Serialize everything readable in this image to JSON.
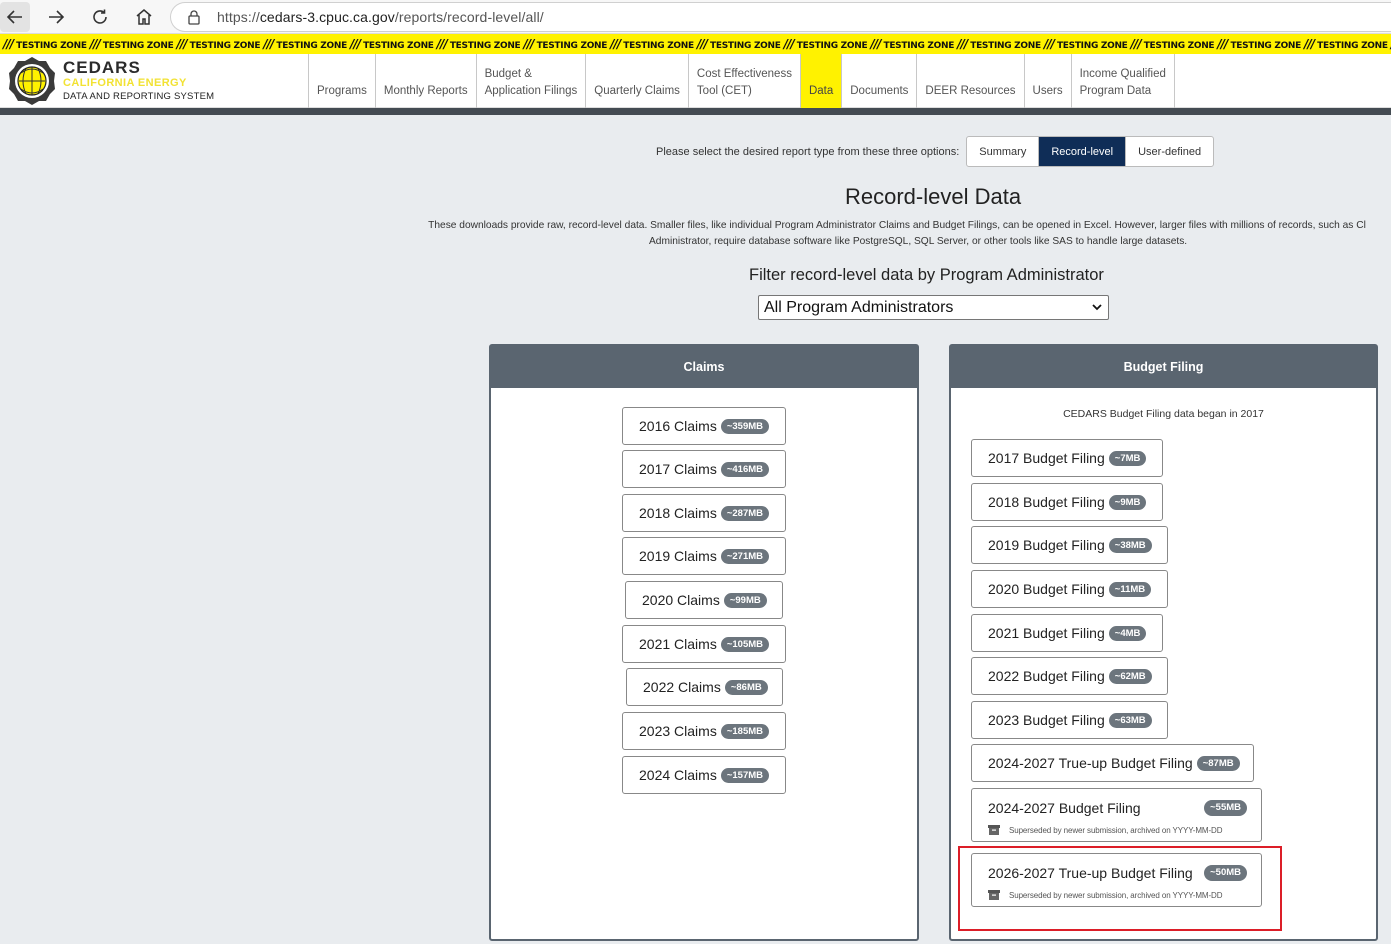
{
  "browser": {
    "url_scheme": "https://",
    "url_host": "cedars-3.cpuc.ca.gov",
    "url_path": "/reports/record-level/all/"
  },
  "testing_zone": {
    "text": "TESTING ZONE",
    "repeat": 19
  },
  "header": {
    "logo_title": "CEDARS",
    "logo_subtitle": "CALIFORNIA ENERGY",
    "logo_subtitle2": "DATA AND REPORTING SYSTEM",
    "nav": [
      {
        "label": "Programs",
        "line2": ""
      },
      {
        "label": "Monthly Reports",
        "line2": ""
      },
      {
        "label": "Budget &",
        "line2": "Application Filings"
      },
      {
        "label": "Quarterly Claims",
        "line2": ""
      },
      {
        "label": "Cost Effectiveness",
        "line2": "Tool (CET)"
      },
      {
        "label": "Data",
        "line2": ""
      },
      {
        "label": "Documents",
        "line2": ""
      },
      {
        "label": "DEER Resources",
        "line2": ""
      },
      {
        "label": "Users",
        "line2": ""
      },
      {
        "label": "Income Qualified",
        "line2": "Program Data"
      }
    ],
    "active_nav": "Data"
  },
  "report_type": {
    "label": "Please select the desired report type from these three options:",
    "options": [
      "Summary",
      "Record-level",
      "User-defined"
    ],
    "selected": "Record-level"
  },
  "page": {
    "title": "Record-level Data",
    "description_line1": "These downloads provide raw, record-level data. Smaller files, like individual Program Administrator Claims and Budget Filings, can be opened in Excel. However, larger files with millions of records, such as Cl",
    "description_line2": "Administrator, require database software like PostgreSQL, SQL Server, or other tools like SAS to handle large datasets."
  },
  "filter": {
    "title": "Filter record-level data by Program Administrator",
    "selected": "All Program Administrators"
  },
  "claims": {
    "header": "Claims",
    "items": [
      {
        "label": "2016 Claims",
        "size": "~359MB"
      },
      {
        "label": "2017 Claims",
        "size": "~416MB"
      },
      {
        "label": "2018 Claims",
        "size": "~287MB"
      },
      {
        "label": "2019 Claims",
        "size": "~271MB"
      },
      {
        "label": "2020 Claims",
        "size": "~99MB"
      },
      {
        "label": "2021 Claims",
        "size": "~105MB"
      },
      {
        "label": "2022 Claims",
        "size": "~86MB"
      },
      {
        "label": "2023 Claims",
        "size": "~185MB"
      },
      {
        "label": "2024 Claims",
        "size": "~157MB"
      }
    ]
  },
  "budget": {
    "header": "Budget Filing",
    "note": "CEDARS Budget Filing data began in 2017",
    "items": [
      {
        "label": "2017 Budget Filing",
        "size": "~7MB"
      },
      {
        "label": "2018 Budget Filing",
        "size": "~9MB"
      },
      {
        "label": "2019 Budget Filing",
        "size": "~38MB"
      },
      {
        "label": "2020 Budget Filing",
        "size": "~11MB"
      },
      {
        "label": "2021 Budget Filing",
        "size": "~4MB"
      },
      {
        "label": "2022 Budget Filing",
        "size": "~62MB"
      },
      {
        "label": "2023 Budget Filing",
        "size": "~63MB"
      },
      {
        "label": "2024-2027 True-up Budget Filing",
        "size": "~87MB"
      }
    ],
    "archived": [
      {
        "label": "2024-2027 Budget Filing",
        "size": "~55MB",
        "note": "Superseded by newer submission, archived on YYYY-MM-DD"
      },
      {
        "label": "2026-2027 True-up Budget Filing",
        "size": "~50MB",
        "note": "Superseded by newer submission, archived on YYYY-MM-DD"
      }
    ]
  },
  "colors": {
    "testing_yellow": "#fff200",
    "header_gray": "#5a6570",
    "selected_navy": "#0f2d57",
    "highlight_red": "#dc1e28"
  }
}
